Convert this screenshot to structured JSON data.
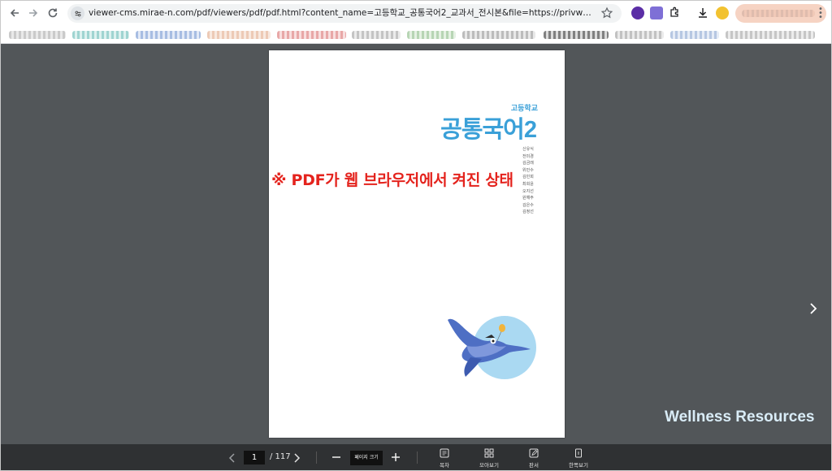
{
  "browser": {
    "url": "viewer-cms.mirae-n.com/pdf/viewers/pdf/pdf.html?content_name=고등학교_공통국어2_교과서_전시본&file=https://privw-cms.mirae-n.com/docum..."
  },
  "document": {
    "school": "고등학교",
    "title": "공통국어2",
    "authors": [
      "신유식",
      "전미경",
      "김금래",
      "위민수",
      "김민회",
      "최희윤",
      "오지선",
      "원해주",
      "김은수",
      "김정선"
    ]
  },
  "overlay_note": "※ PDF가 웹 브라우저에서 켜진 상태",
  "watermark": "Wellness Resources",
  "viewer_toolbar": {
    "current_page": "1",
    "total_pages": "/ 117",
    "zoom_label": "페이지 크기",
    "tools": [
      {
        "label": "목차",
        "icon": "toc-icon"
      },
      {
        "label": "모아보기",
        "icon": "grid-icon"
      },
      {
        "label": "판서",
        "icon": "pen-icon"
      },
      {
        "label": "한쪽보기",
        "icon": "single-page-icon"
      }
    ]
  }
}
